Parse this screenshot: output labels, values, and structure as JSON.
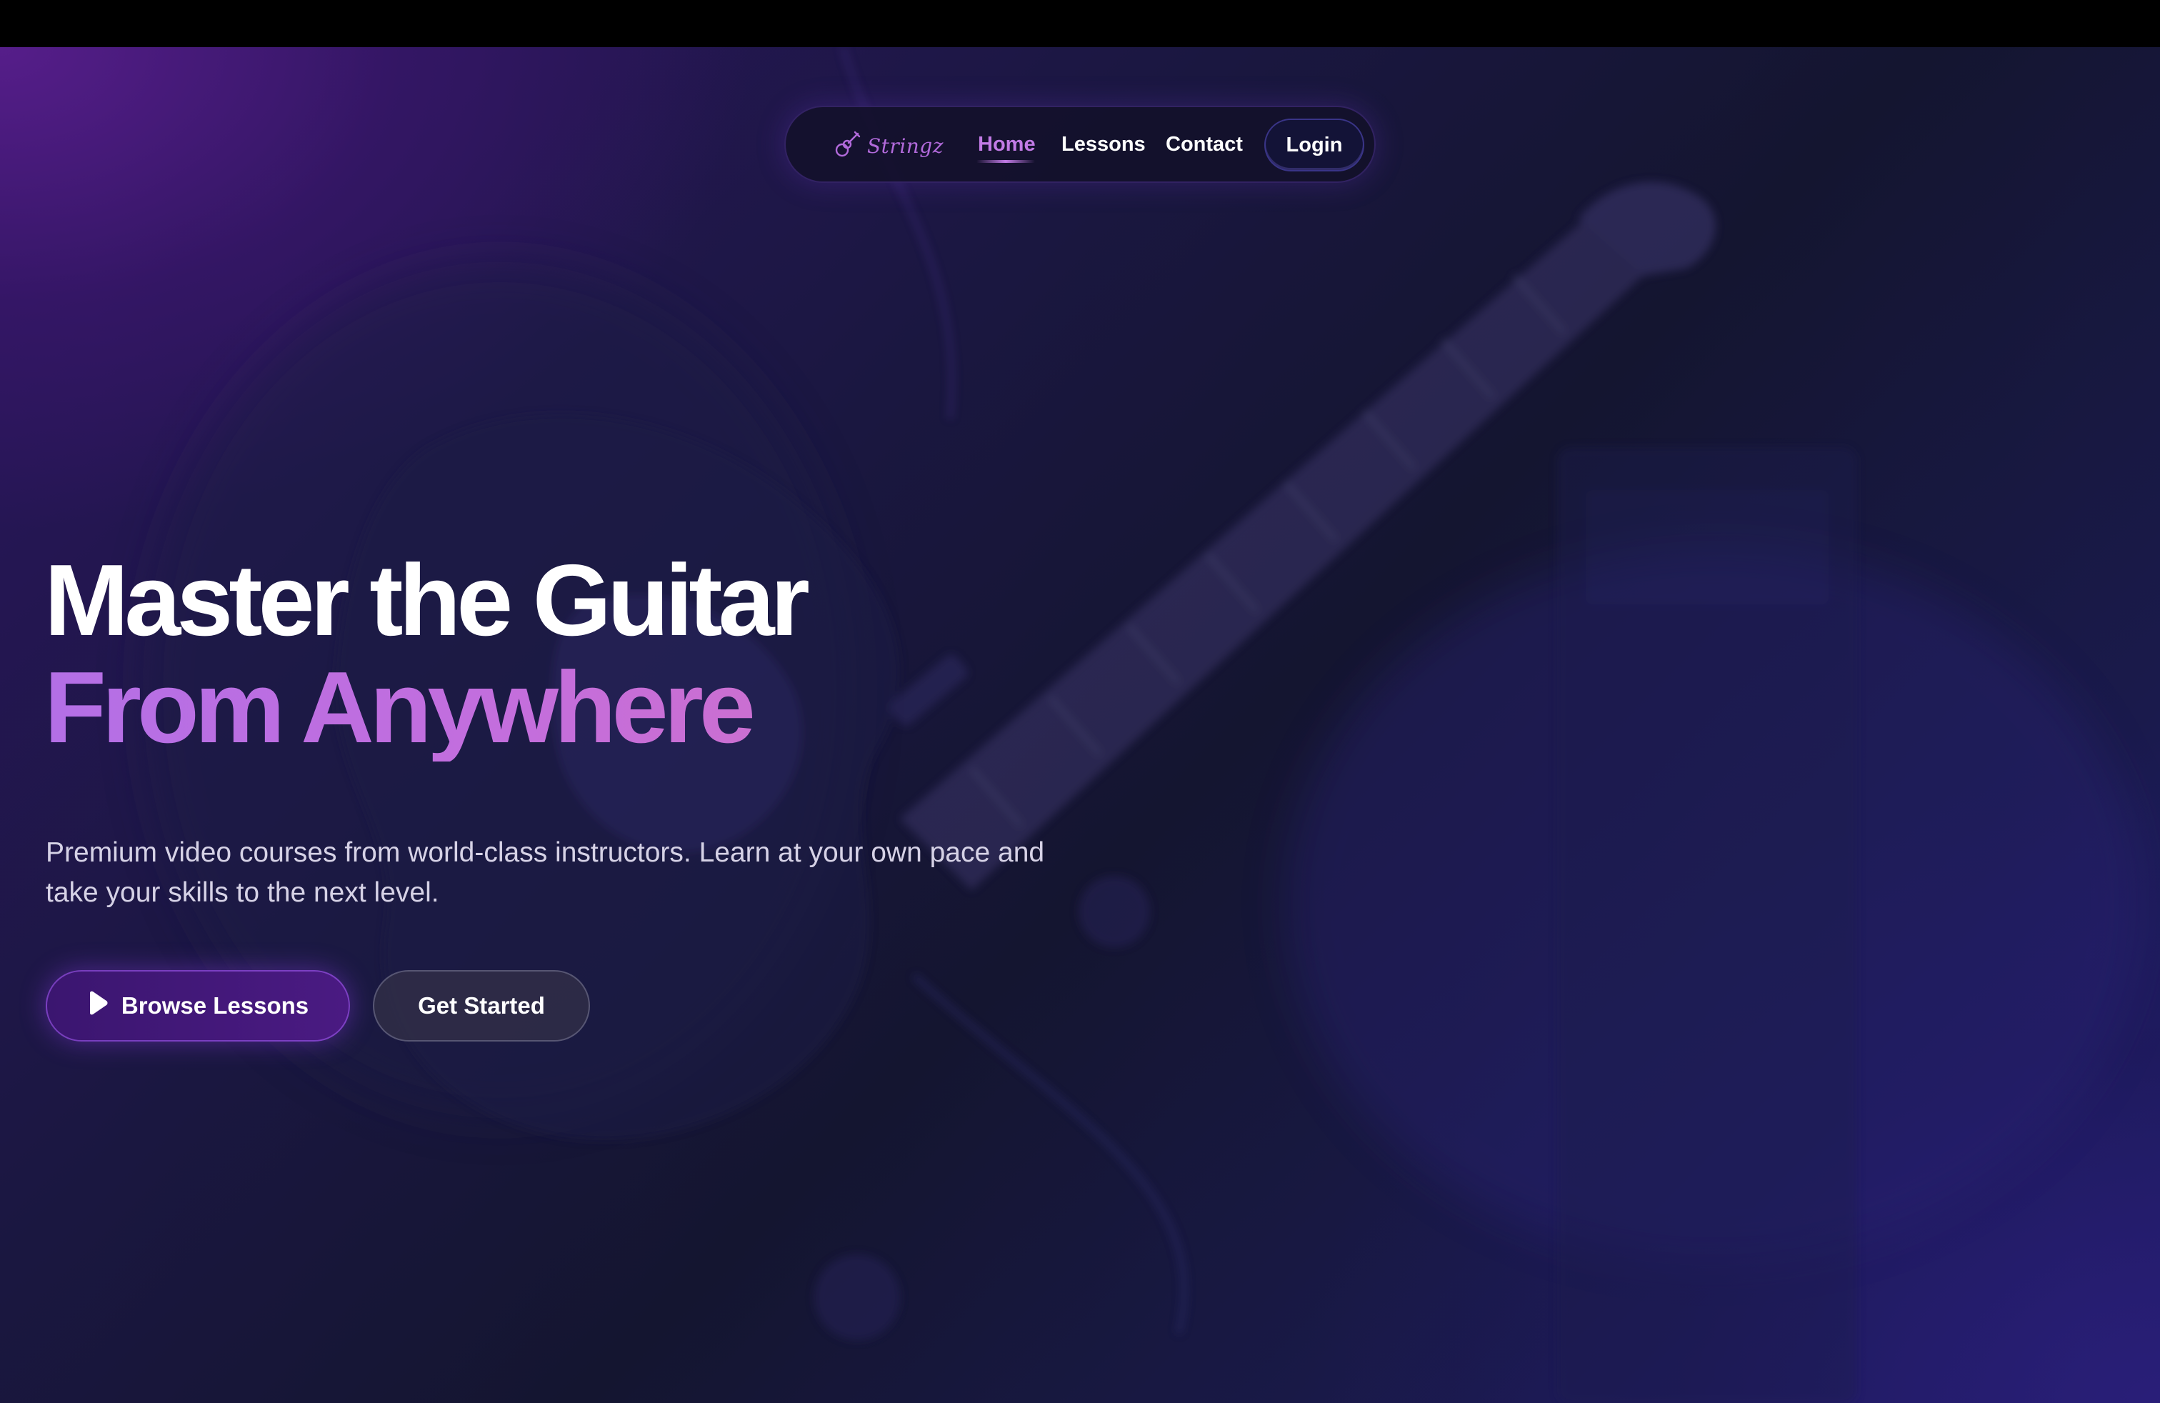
{
  "nav": {
    "logo_text": "Stringz",
    "links": [
      {
        "label": "Home",
        "active": true
      },
      {
        "label": "Lessons",
        "active": false
      },
      {
        "label": "Contact",
        "active": false
      }
    ],
    "login_label": "Login"
  },
  "hero": {
    "title_line1": "Master the Guitar",
    "title_line2": "From Anywhere",
    "subtitle": "Premium video courses from world-class instructors. Learn at your own pace and take your skills to the next level.",
    "primary_button": "Browse Lessons",
    "secondary_button": "Get Started"
  },
  "colors": {
    "accent": "#c27be6",
    "title_gradient_start": "#b46fe6",
    "title_gradient_end": "#cc6fcf",
    "background_dark": "#141530",
    "background_purple": "#2c1660"
  },
  "icons": {
    "logo": "guitar-icon",
    "primary_button": "play-icon"
  }
}
